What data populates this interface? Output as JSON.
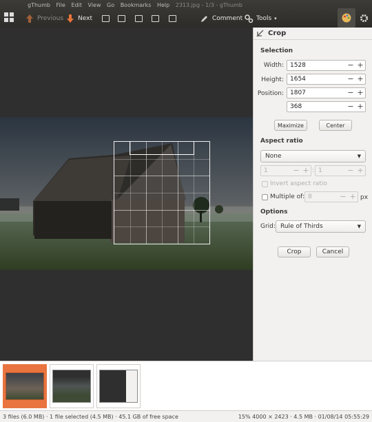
{
  "window": {
    "title_fragment": "2313.jpg - 1/3 - gThumb",
    "menu": [
      "gThumb",
      "File",
      "Edit",
      "View",
      "Go",
      "Bookmarks",
      "Help"
    ]
  },
  "toolbar": {
    "previous_label": "Previous",
    "next_label": "Next",
    "comment_label": "Comment",
    "tools_label": "Tools"
  },
  "crop_panel": {
    "title": "Crop",
    "selection": {
      "title": "Selection",
      "width_label": "Width:",
      "width_value": "1528",
      "height_label": "Height:",
      "height_value": "1654",
      "position_label": "Position:",
      "position_x": "1807",
      "position_y": "368",
      "maximize_label": "Maximize",
      "center_label": "Center"
    },
    "aspect_ratio": {
      "title": "Aspect ratio",
      "selected": "None",
      "ratio_a": "1",
      "ratio_sep": ":",
      "ratio_b": "1",
      "invert_label": "Invert aspect ratio",
      "multiple_label": "Multiple of:",
      "multiple_value": "8",
      "multiple_unit": "px"
    },
    "options": {
      "title": "Options",
      "grid_label": "Grid:",
      "grid_value": "Rule of Thirds"
    },
    "crop_button": "Crop",
    "cancel_button": "Cancel"
  },
  "statusbar": {
    "left": "3 files (6.0 MB) · 1 file selected (4.5 MB) · 45.1 GB of free space",
    "right": "15%  4000 × 2423 · 4.5 MB · 01/08/14 05:55:29"
  },
  "colors": {
    "toolbar_bg": "#2f2e2a",
    "selected_thumb": "#e9743f",
    "viewer_bg": "#2f2f2f"
  }
}
